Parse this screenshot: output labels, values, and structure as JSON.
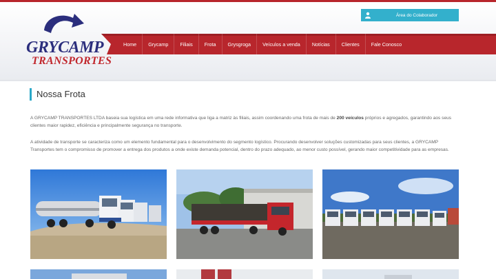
{
  "logo": {
    "line1": "GRYCAMP",
    "line2": "TRANSPORTES",
    "arrow_icon": "curved-arrow-icon"
  },
  "employee_area": {
    "label": "Área do Colaborador",
    "icon": "user-icon"
  },
  "nav": {
    "items": [
      "Home",
      "Grycamp",
      "Filiais",
      "Frota",
      "Grysgroga",
      "Veículos a venda",
      "Notícias",
      "Clientes",
      "Fale Conosco"
    ]
  },
  "page": {
    "title": "Nossa Frota",
    "para1_before": "A GRYCAMP TRANSPORTES LTDA baseia sua logística em uma rede informativa que liga a matriz às filiais, assim coordenando uma frota de mais de ",
    "para1_bold": "200 veículos",
    "para1_after": " próprios e agregados, garantindo aos seus clientes maior rapidez, eficiência e principalmente segurança no transporte.",
    "para2": "A atividade de transporte se caracteriza como um elemento fundamental para o desenvolvimento do segmento logístico. Procurando desenvolver soluções customizadas para seus clientes, a GRYCAMP Transportes tem o compromisso de promover a entrega dos produtos a onde existe demanda potencial, dentro do prazo adequado, ao menor custo possível, gerando maior competitividade para as empresas."
  },
  "colors": {
    "brand_red": "#b8262c",
    "brand_blue": "#2b2e7d",
    "accent_cyan": "#33b0cc"
  }
}
